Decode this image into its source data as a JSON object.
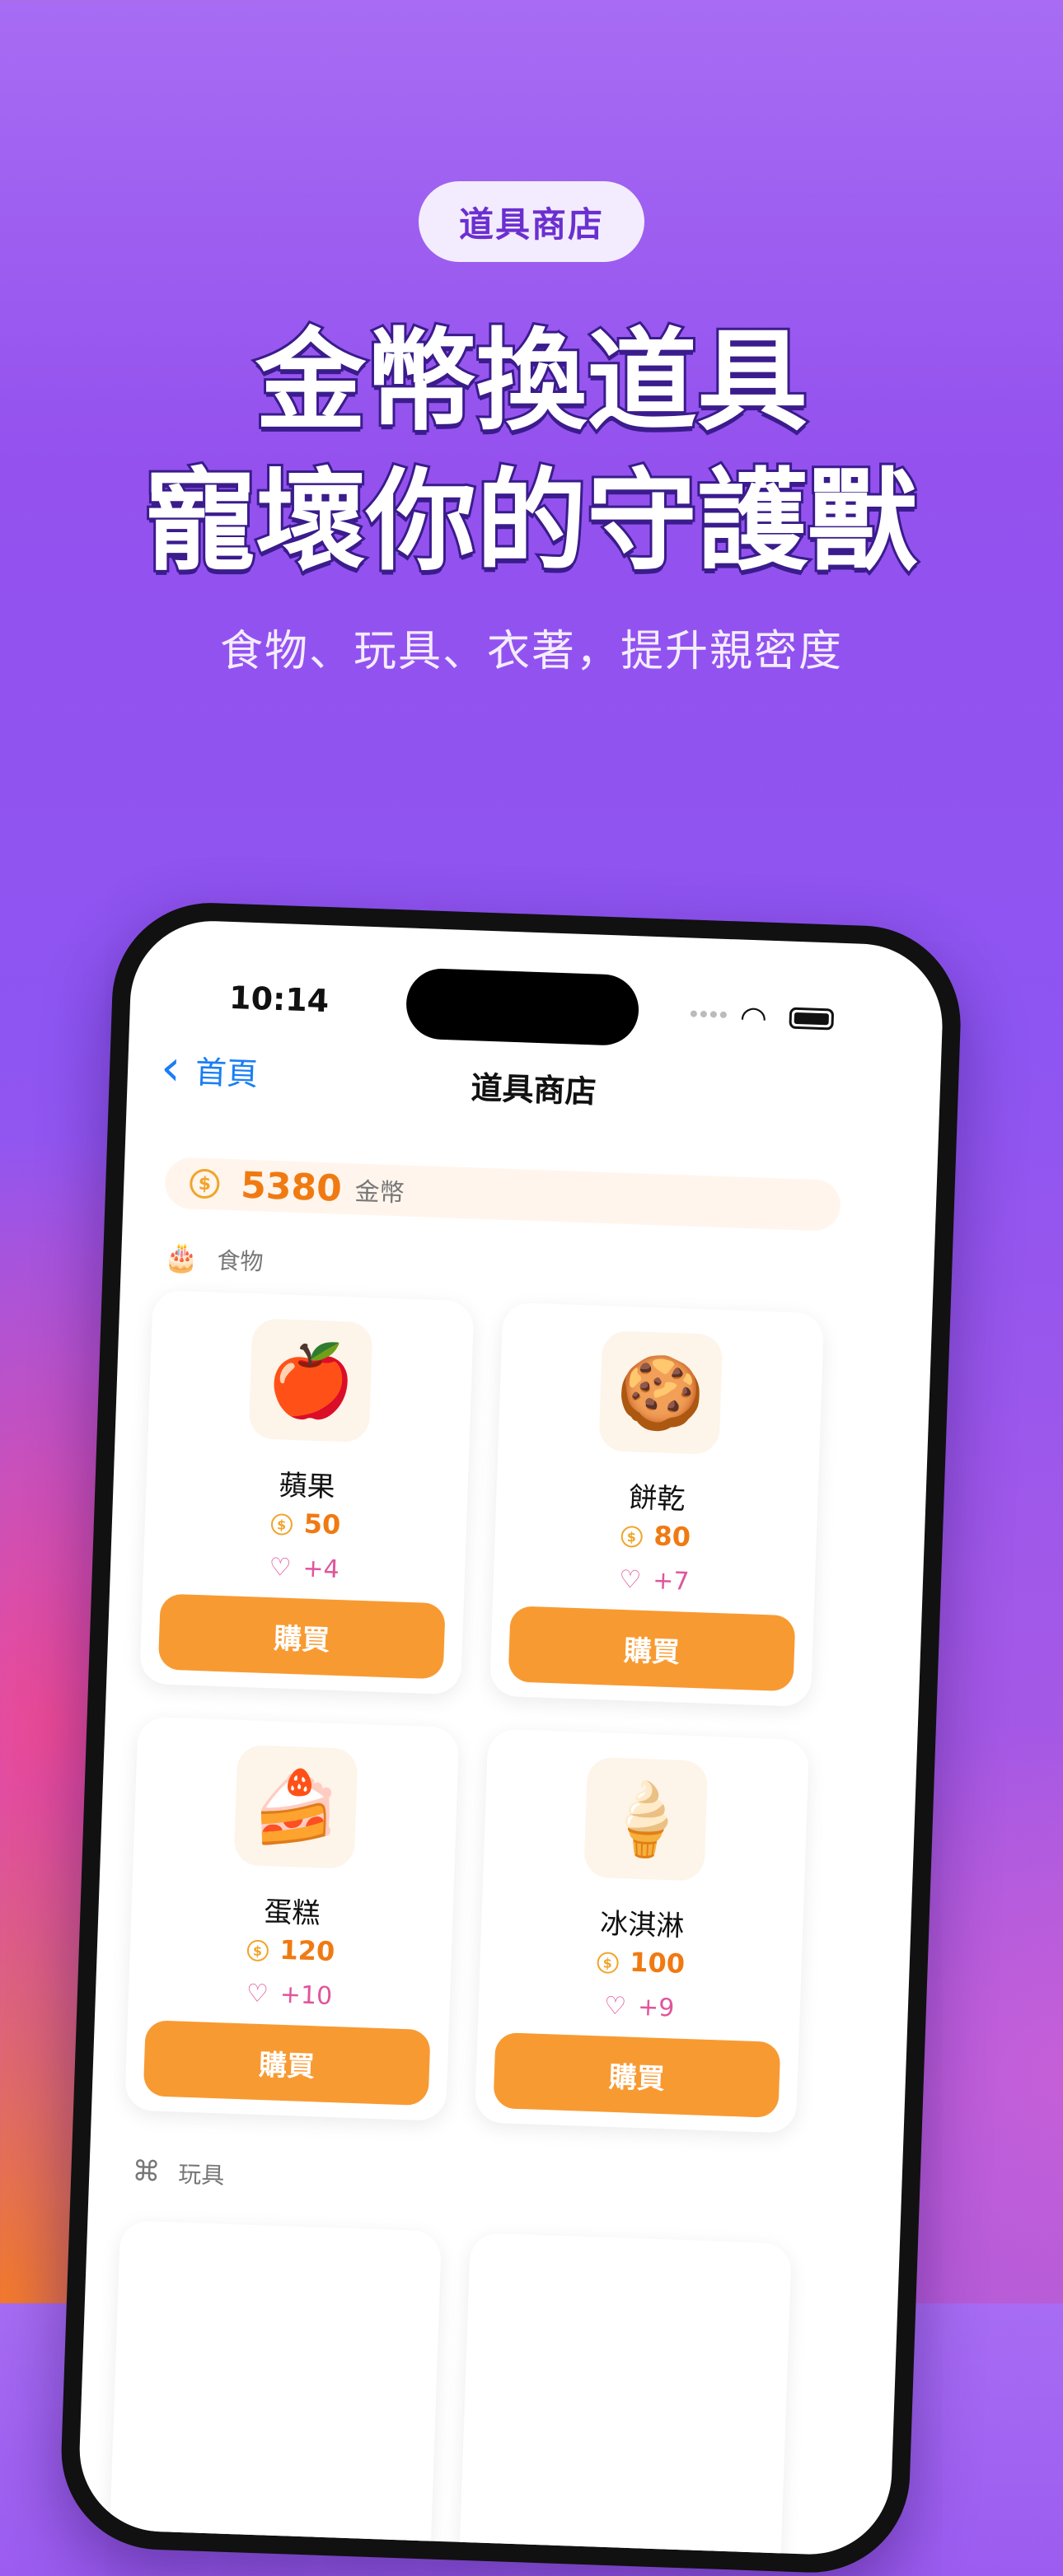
{
  "hero": {
    "badge": "道具商店",
    "headline_line1": "金幣換道具",
    "headline_line2": "寵壞你的守護獸",
    "subtitle": "食物、玩具、衣著，提升親密度"
  },
  "status_bar": {
    "time": "10:14"
  },
  "nav": {
    "back_label": "首頁",
    "title": "道具商店"
  },
  "wallet": {
    "amount": "5380",
    "unit": "金幣"
  },
  "sections": {
    "food": {
      "label": "食物",
      "icon": "cake-icon"
    },
    "toys": {
      "label": "玩具",
      "icon": "puzzle-icon"
    }
  },
  "food_items": [
    {
      "name": "蘋果",
      "price": "50",
      "affection": "+4",
      "buy_label": "購買",
      "icon": "apple-icon"
    },
    {
      "name": "餅乾",
      "price": "80",
      "affection": "+7",
      "buy_label": "購買",
      "icon": "cookie-icon"
    },
    {
      "name": "蛋糕",
      "price": "120",
      "affection": "+10",
      "buy_label": "購買",
      "icon": "cake-slice-icon"
    },
    {
      "name": "冰淇淋",
      "price": "100",
      "affection": "+9",
      "buy_label": "購買",
      "icon": "ice-cream-icon"
    }
  ],
  "colors": {
    "accent_orange": "#f89a32",
    "price_orange": "#f07a12",
    "affection_pink": "#e0559c",
    "link_blue": "#1a7ef5",
    "badge_text_purple": "#6b2fd0"
  }
}
